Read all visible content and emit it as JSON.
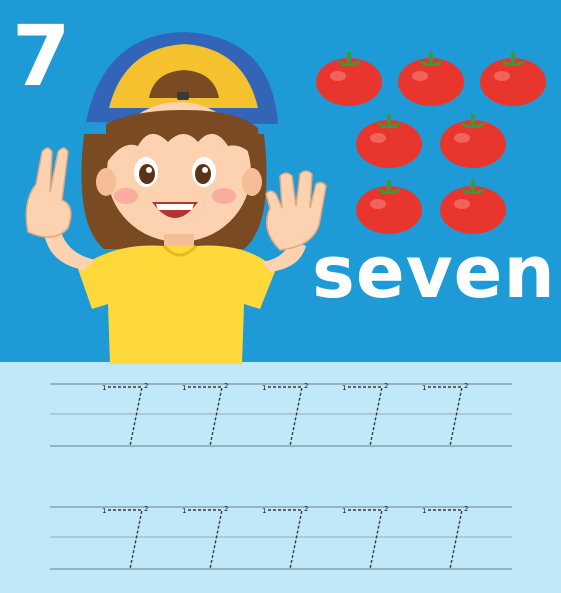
{
  "worksheet": {
    "number": "7",
    "word": "seven",
    "object_icon": "tomato-icon",
    "object_count": 7,
    "tracing_rows": 2,
    "tracing_digits_per_row": 5,
    "stroke_marks": [
      "1",
      "2"
    ]
  },
  "colors": {
    "top_background": "#1e9ad6",
    "bottom_background": "#bfe9f8",
    "tomato": "#e8362f",
    "shirt": "#ffd83a",
    "cap_front": "#f5c12e",
    "cap_back": "#3264b8"
  }
}
